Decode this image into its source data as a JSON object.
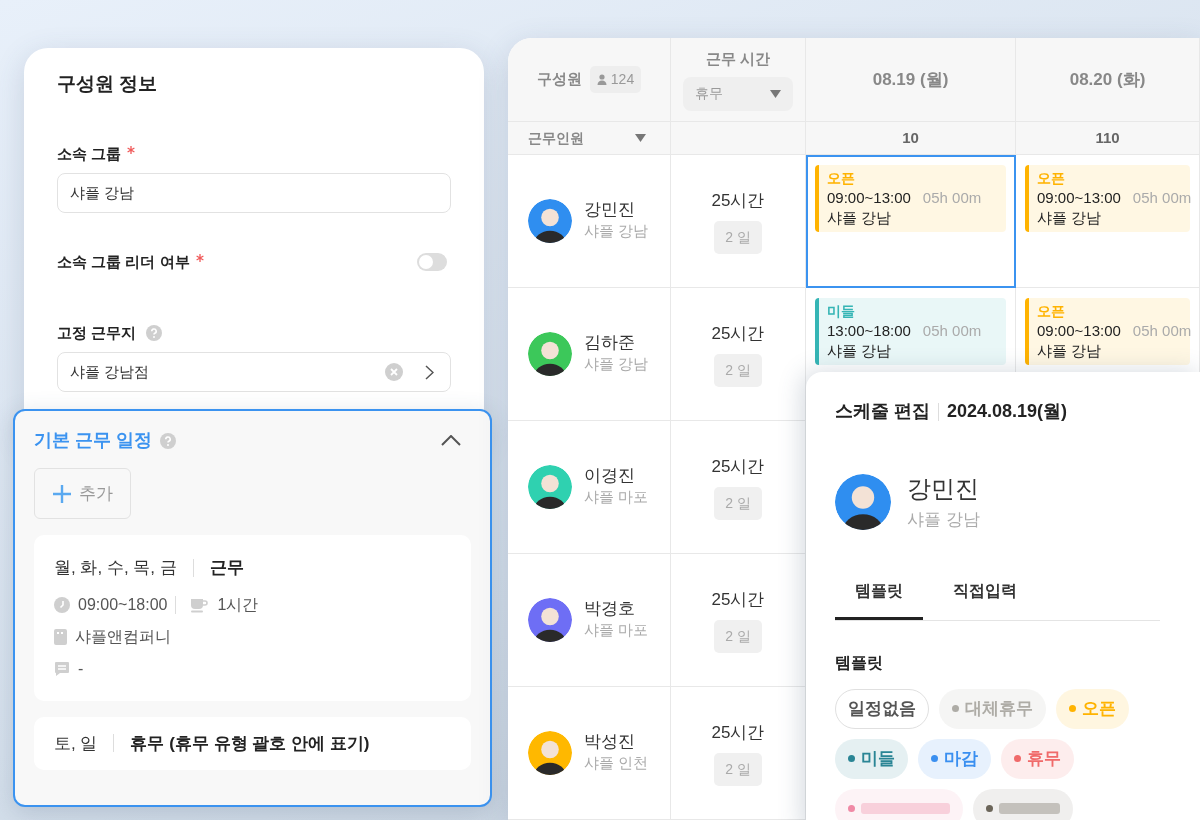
{
  "member_form": {
    "title": "구성원 정보",
    "fields": [
      {
        "kind": "text",
        "label": "소속 그룹",
        "required": true,
        "value": "샤플 강남"
      },
      {
        "kind": "toggle",
        "label": "소속 그룹 리더 여부",
        "required": true,
        "on": false
      },
      {
        "kind": "select",
        "label": "고정 근무지",
        "help": true,
        "value": "샤플 강남점"
      }
    ]
  },
  "default_schedule": {
    "title": "기본 근무 일정",
    "help": true,
    "expanded": true,
    "add_button": "추가",
    "entries": [
      {
        "days": "월, 화, 수, 목, 금",
        "type": "근무",
        "time": "09:00~18:00",
        "break": "1시간",
        "place": "샤플앤컴퍼니",
        "memo": "-"
      },
      {
        "days": "토, 일",
        "type": "휴무 (휴무 유형 괄호 안에 표기)"
      }
    ]
  },
  "table": {
    "member_header": "구성원",
    "member_count": "124",
    "hours_header": "근무 시간",
    "hours_filter": "휴무",
    "staff_filter": "근무인원",
    "dates": [
      {
        "label": "08.19 (월)",
        "count": "10"
      },
      {
        "label": "08.20 (화)",
        "count": "110"
      }
    ],
    "rows": [
      {
        "name": "강민진",
        "group": "샤플 강남",
        "color": "#2f8ef0",
        "hours": "25시간",
        "days": "2 일",
        "shifts": [
          {
            "label": "오픈",
            "time": "09:00~13:00",
            "duration": "05h 00m",
            "place": "샤플 강남",
            "color": "#ffb300",
            "selected": true
          },
          {
            "label": "오픈",
            "time": "09:00~13:00",
            "duration": "05h 00m",
            "place": "샤플 강남",
            "color": "#ffb300",
            "selected": false
          }
        ]
      },
      {
        "name": "김하준",
        "group": "샤플 강남",
        "color": "#3cc85a",
        "hours": "25시간",
        "days": "2 일",
        "shifts": [
          {
            "label": "미들",
            "time": "13:00~18:00",
            "duration": "05h 00m",
            "place": "샤플 강남",
            "color": "#35b5b5",
            "selected": false
          },
          {
            "label": "오픈",
            "time": "09:00~13:00",
            "duration": "05h 00m",
            "place": "샤플 강남",
            "color": "#ffb300",
            "selected": false
          }
        ]
      },
      {
        "name": "이경진",
        "group": "샤플 마포",
        "color": "#2fd1b0",
        "hours": "25시간",
        "days": "2 일",
        "shifts": []
      },
      {
        "name": "박경호",
        "group": "샤플 마포",
        "color": "#6e6ef5",
        "hours": "25시간",
        "days": "2 일",
        "shifts": []
      },
      {
        "name": "박성진",
        "group": "샤플 인천",
        "color": "#ffb800",
        "hours": "25시간",
        "days": "2 일",
        "shifts": []
      }
    ]
  },
  "schedule_editor": {
    "title": "스케줄 편집",
    "date": "2024.08.19(월)",
    "name": "강민진",
    "group": "샤플 강남",
    "color": "#2f8ef0",
    "tabs": [
      {
        "label": "템플릿",
        "selected": true
      },
      {
        "label": "직접입력",
        "selected": false
      }
    ],
    "section_title": "템플릿",
    "templates": [
      {
        "kind": "outline",
        "label": "일정없음"
      },
      {
        "kind": "dot",
        "label": "대체휴무",
        "color": "#aeaca6"
      },
      {
        "kind": "dot",
        "label": "오픈",
        "color": "#ffb300"
      },
      {
        "kind": "dot",
        "label": "미들",
        "color": "#2a8595"
      },
      {
        "kind": "dot",
        "label": "마감",
        "color": "#3a8ff0"
      },
      {
        "kind": "dot",
        "label": "휴무",
        "color": "#f06a6a"
      },
      {
        "kind": "blank",
        "color": "#f08aa6"
      },
      {
        "kind": "blank",
        "color": "#6b6559"
      }
    ]
  }
}
